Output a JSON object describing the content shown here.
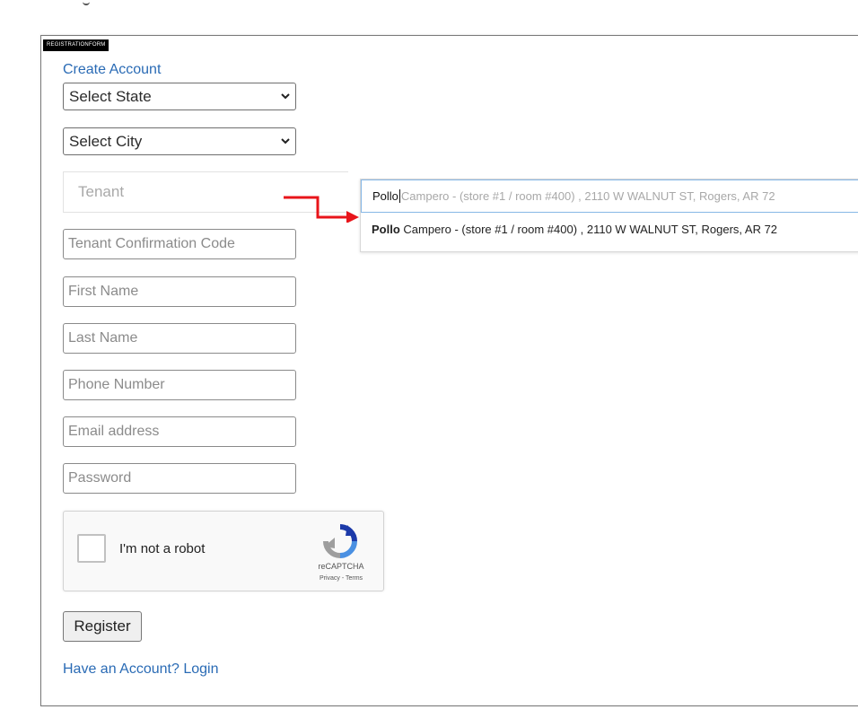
{
  "form_tag": "REGISTRATIONFORM",
  "heading": "Create Account",
  "state_select": {
    "value": "Select State"
  },
  "city_select": {
    "value": "Select City"
  },
  "tenant": {
    "placeholder": "Tenant"
  },
  "fields": {
    "tenant_code": {
      "placeholder": "Tenant Confirmation Code"
    },
    "first_name": {
      "placeholder": "First Name"
    },
    "last_name": {
      "placeholder": "Last Name"
    },
    "phone": {
      "placeholder": "Phone Number"
    },
    "email": {
      "placeholder": "Email address"
    },
    "password": {
      "placeholder": "Password"
    }
  },
  "autocomplete": {
    "typed": "Pollo",
    "hint": "Campero - (store #1 / room #400) , 2110 W WALNUT ST, Rogers, AR 72",
    "suggestion_bold": "Pollo",
    "suggestion_rest": " Campero - (store #1 / room #400) , 2110 W WALNUT ST, Rogers, AR 72"
  },
  "captcha": {
    "label": "I'm not a robot",
    "brand": "reCAPTCHA",
    "links": "Privacy - Terms"
  },
  "register_label": "Register",
  "login_link": "Have an Account? Login",
  "colors": {
    "link": "#2a6bb5",
    "annotation_arrow": "#e8141a",
    "input_focus": "#86b7e6"
  },
  "icons": [
    "chevron-down-icon",
    "red-arrow-annotation",
    "recaptcha-logo-icon"
  ]
}
